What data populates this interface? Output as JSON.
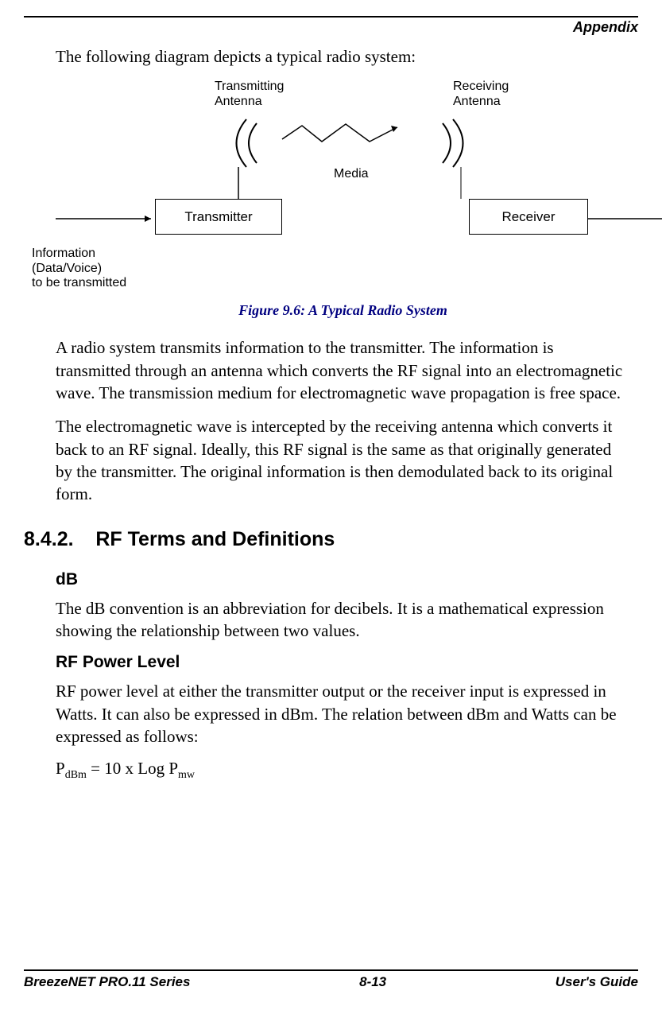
{
  "header": {
    "appendix": "Appendix"
  },
  "intro": "The following diagram depicts a typical radio system:",
  "diagram": {
    "tx_antenna_line1": "Transmitting",
    "tx_antenna_line2": "Antenna",
    "rx_antenna_line1": "Receiving",
    "rx_antenna_line2": "Antenna",
    "media": "Media",
    "transmitter": "Transmitter",
    "receiver": "Receiver",
    "info_line1": "Information",
    "info_line2": "(Data/Voice)",
    "info_line3": "to be transmitted"
  },
  "figure_caption": "Figure 9.6: A Typical Radio System",
  "para1": "A radio system transmits information to the transmitter. The information is transmitted through an antenna which converts the RF signal into an electromagnetic wave. The transmission medium for electromagnetic wave propagation is free space.",
  "para2": "The electromagnetic wave is intercepted by the receiving antenna which converts it back to an RF signal. Ideally, this RF signal is the same as that originally generated by the transmitter. The original information is then demodulated back to its original form.",
  "section": {
    "number": "8.4.2.",
    "title": "RF Terms and Definitions"
  },
  "db": {
    "heading": "dB",
    "text": "The dB convention is an abbreviation for decibels. It is a mathematical expression showing the relationship between two values."
  },
  "rfpower": {
    "heading": "RF Power Level",
    "text": "RF power level at either the transmitter output or the receiver input is expressed in Watts. It can also be expressed in dBm. The relation between dBm and Watts can be expressed as follows:"
  },
  "formula": {
    "p": "P",
    "sub1": "dBm",
    "eq": " = 10 x Log P",
    "sub2": "mw"
  },
  "footer": {
    "left": "BreezeNET PRO.11 Series",
    "center": "8-13",
    "right": "User's Guide"
  }
}
